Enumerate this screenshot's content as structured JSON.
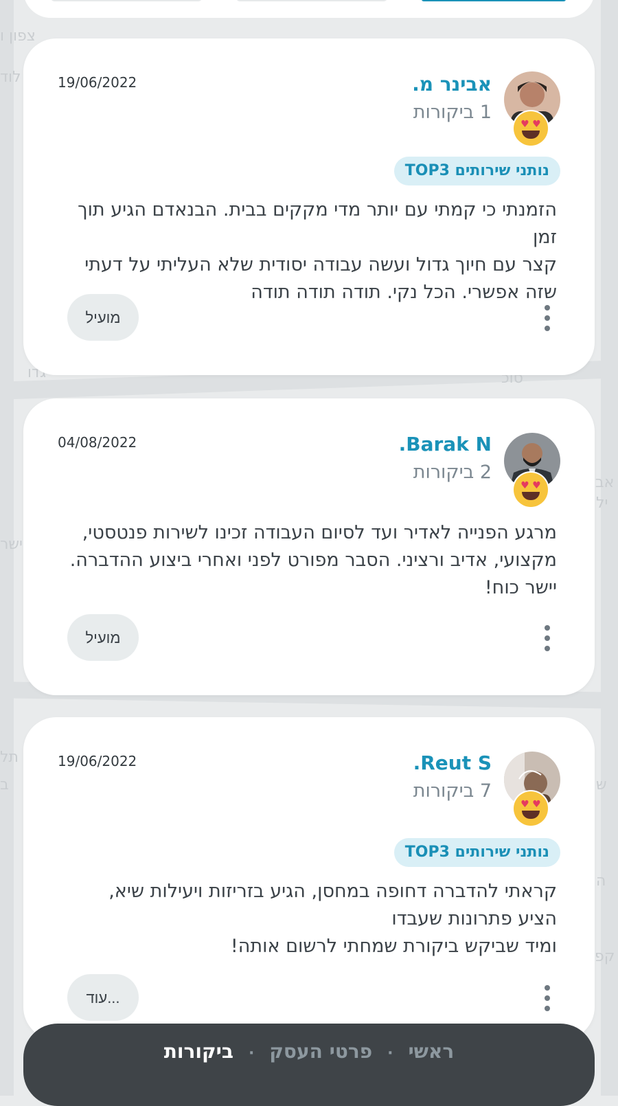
{
  "map_labels": [
    "צפון ו",
    "לוד",
    "גדו",
    "סוכ",
    "אבי",
    "ילו",
    "ישר",
    "תל",
    "ב",
    "ש",
    "קפ",
    "ה"
  ],
  "reviews": [
    {
      "name": "אבינר מ.",
      "count": "1 ביקורות",
      "date": "19/06/2022",
      "badge": "נותני שירותים TOP3",
      "text": "הזמנתי כי קמתי עם יותר מדי מקקים בבית. הבנאדם הגיע תוך זמן\nקצר עם חיוך גדול ועשה עבודה יסודית שלא העליתי על דעתי\nשזה אפשרי. הכל נקי. תודה תודה תודה",
      "button": "מועיל",
      "avatar_color": "#c98a6a",
      "emoji": "heart-eyes-emoji"
    },
    {
      "name": "Barak N.",
      "count": "2 ביקורות",
      "date": "04/08/2022",
      "text": "מרגע הפנייה לאדיר ועד לסיום העבודה זכינו לשירות פנטסטי,\nמקצועי, אדיב ורציני. הסבר מפורט לפני ואחרי ביצוע ההדברה.\nיישר כוח!",
      "button": "מועיל",
      "avatar_color": "#4a4e54",
      "emoji": "heart-eyes-emoji"
    },
    {
      "name": "Reut S.",
      "count": "7 ביקורות",
      "date": "19/06/2022",
      "badge": "נותני שירותים TOP3",
      "text": "קראתי להדברה דחופה במחסן, הגיע בזריזות ויעילות שיא,\nהציע פתרונות שעבדו\nומיד שביקש ביקורת שמחתי לרשום אותה!",
      "button": "עוד...",
      "avatar_color": "#8a6a55",
      "emoji": "heart-eyes-emoji"
    }
  ],
  "nav": {
    "home": "ראשי",
    "business": "פרטי העסק",
    "reviews": "ביקורות",
    "separator": "·",
    "active": "reviews"
  },
  "colors": {
    "accent": "#1a92b8",
    "badge_bg": "#d9eff6",
    "nav_bg": "#3f4448",
    "card_bg": "#ffffff"
  }
}
